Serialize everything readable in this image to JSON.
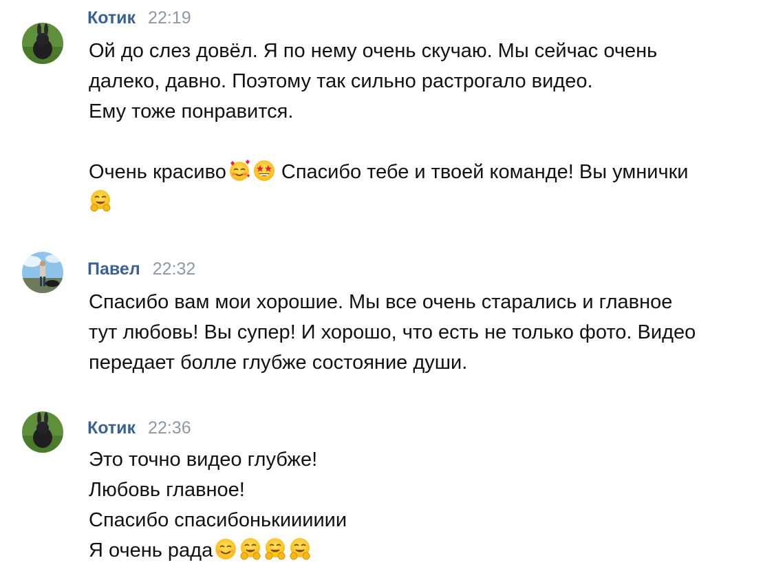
{
  "messages": [
    {
      "author": "Котик",
      "time": "22:19",
      "lines": [
        "Ой до слез довёл. Я по нему очень скучаю. Мы сейчас очень",
        "далеко, давно. Поэтому так сильно растрогало видео.",
        "Ему тоже понравится."
      ],
      "line4_text_a": "Очень красиво",
      "line4_text_b": " Спасибо тебе и твоей команде! Вы умнички",
      "emojis_line4": [
        "smiling-face-with-hearts-emoji",
        "star-struck-emoji"
      ],
      "emojis_line5": [
        "hugging-face-emoji"
      ]
    },
    {
      "author": "Павел",
      "time": "22:32",
      "lines": [
        "Спасибо вам мои хорошие. Мы все очень старались и главное",
        "тут любовь! Вы супер! И хорошо, что есть не только фото. Видео",
        "передает болле глубже состояние души."
      ]
    },
    {
      "author": "Котик",
      "time": "22:36",
      "lines": [
        "Это точно видео глубже!",
        "Любовь главное!",
        "Спасибо спасибонькииииии",
        "Я очень рада"
      ],
      "emojis_last_line": [
        "smiling-face-emoji",
        "hugging-face-emoji",
        "hugging-face-emoji",
        "hugging-face-emoji"
      ]
    }
  ],
  "colors": {
    "author": "#3a6290",
    "time": "#8d99a6",
    "text": "#111111",
    "background": "#ffffff"
  }
}
